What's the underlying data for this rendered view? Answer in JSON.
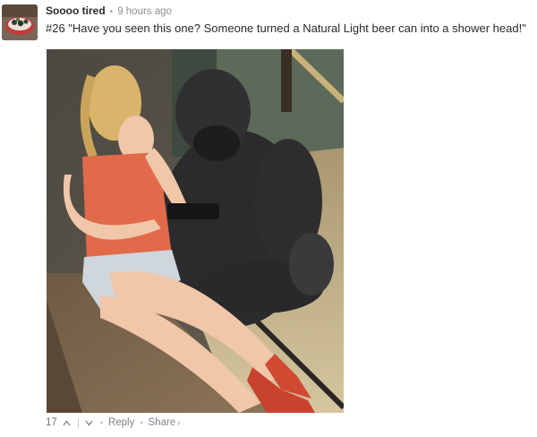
{
  "comment": {
    "username": "Soooo tired",
    "timestamp": "9 hours ago",
    "text": "#26 \"Have you seen this one? Someone turned a Natural Light beer can into a shower head!\"",
    "footer": {
      "vote_count": "17",
      "upvote_icon": "^",
      "downvote_icon": "v",
      "reply_label": "Reply",
      "share_label": "Share",
      "share_caret": "›"
    }
  },
  "colors": {
    "username": "#2a2a2a",
    "meta_text": "#8a8f94",
    "body_text": "#2a2a2a"
  }
}
